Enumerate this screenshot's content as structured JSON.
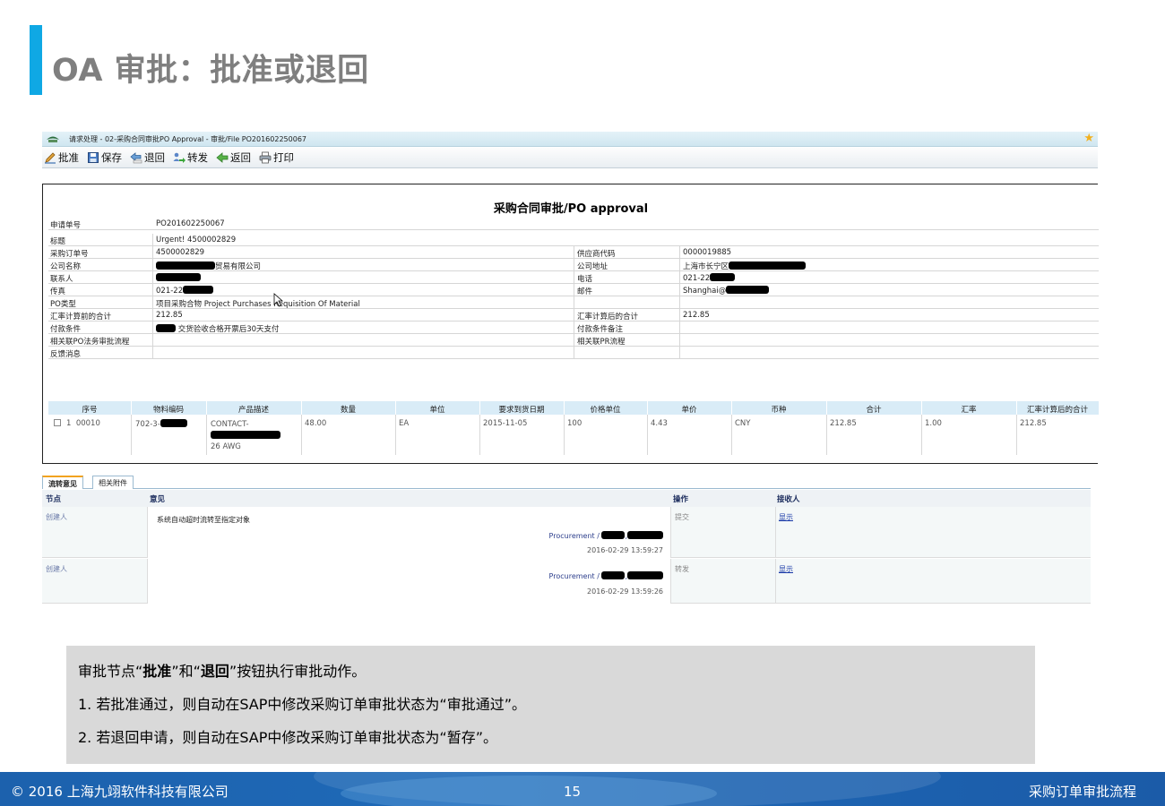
{
  "slide": {
    "title": "OA 审批：批准或退回",
    "accent_color": "#0fa8e4"
  },
  "window": {
    "title": "请求处理 - 02-采购合同审批PO Approval - 审批/File PO201602250067",
    "star_icon": "favorite-star-icon"
  },
  "toolbar": {
    "approve": "批准",
    "save": "保存",
    "reject": "退回",
    "forward": "转发",
    "back": "返回",
    "print": "打印"
  },
  "form": {
    "title": "采购合同审批/PO approval",
    "request_no_label": "申请单号",
    "request_no": "PO201602250067",
    "subject_label": "标题",
    "subject": "Urgent! 4500002829",
    "po_no_label": "采购订单号",
    "po_no": "4500002829",
    "vendor_code_label": "供应商代码",
    "vendor_code": "0000019885",
    "company_label": "公司名称",
    "company_suffix": "贸易有限公司",
    "address_label": "公司地址",
    "address_prefix": "上海市长宁区",
    "contact_label": "联系人",
    "phone_label": "电话",
    "phone_prefix": "021-22",
    "fax_label": "传真",
    "fax_prefix": "021-22",
    "email_label": "邮件",
    "email_prefix": "Shanghai@",
    "po_type_label": "PO类型",
    "po_type": "项目采购合物 Project Purchases Requisition Of Material",
    "total_before_label": "汇率计算前的合计",
    "total_before": "212.85",
    "total_after_label": "汇率计算后的合计",
    "total_after": "212.85",
    "payment_label": "付款条件",
    "payment": "交货验收合格开票后30天支付",
    "payment_note_label": "付款条件备注",
    "po_legal_label": "相关联PO法务审批流程",
    "pr_flow_label": "相关联PR流程",
    "feedback_label": "反馈消息"
  },
  "items": {
    "headers": [
      "序号",
      "物料编码",
      "产品描述",
      "数量",
      "单位",
      "要求到货日期",
      "价格单位",
      "单价",
      "币种",
      "合计",
      "汇率",
      "汇率计算后的合计"
    ],
    "row": {
      "seq": "1",
      "line": "00010",
      "material_prefix": "702-3-",
      "desc_line1": "CONTACT-",
      "desc_line3": "26 AWG",
      "qty": "48.00",
      "unit": "EA",
      "date": "2015-11-05",
      "price_unit": "100",
      "price": "4.43",
      "currency": "CNY",
      "total": "212.85",
      "rate": "1.00",
      "total_after": "212.85"
    }
  },
  "tabs": {
    "flow": "流转意见",
    "attachments": "相关附件"
  },
  "flow": {
    "headers": {
      "node": "节点",
      "opinion": "意见",
      "op": "操作",
      "recv": "接收人"
    },
    "rows": [
      {
        "node": "创建人",
        "text": "系统自动超时流转至指定对象",
        "proc": "Procurement /",
        "time": "2016-02-29  13:59:27",
        "op": "提交",
        "recv": "显示"
      },
      {
        "node": "创建人",
        "text": "",
        "proc": "Procurement /",
        "time": "2016-02-29  13:59:26",
        "op": "转发",
        "recv": "显示"
      }
    ]
  },
  "note": {
    "line1_pre": "审批节点“",
    "line1_b1": "批准",
    "line1_mid": "”和“",
    "line1_b2": "退回",
    "line1_post": "”按钮执行审批动作。",
    "line2": "1.  若批准通过，则自动在SAP中修改采购订单审批状态为“审批通过”。",
    "line3": "2.  若退回申请，则自动在SAP中修改采购订单审批状态为“暂存”。"
  },
  "footer": {
    "copyright": "© 2016 上海九翊软件科技有限公司",
    "page": "15",
    "section": "采购订单审批流程"
  }
}
